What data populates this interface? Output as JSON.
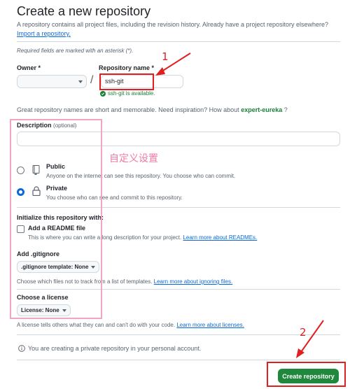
{
  "header": {
    "title": "Create a new repository",
    "subtitle": "A repository contains all project files, including the revision history. Already have a project repository elsewhere?",
    "import_link": "Import a repository."
  },
  "required_note": "Required fields are marked with an asterisk (*).",
  "owner": {
    "label": "Owner *",
    "value": ""
  },
  "slash": "/",
  "repo_name": {
    "label": "Repository name *",
    "value": "ssh-git",
    "availability": "ssh-git is available."
  },
  "suggestion": {
    "text": "Great repository names are short and memorable. Need inspiration? How about",
    "name": "expert-eureka",
    "suffix": "?"
  },
  "description": {
    "label": "Description",
    "optional": "(optional)",
    "value": ""
  },
  "visibility": [
    {
      "label": "Public",
      "desc": "Anyone on the internet can see this repository. You choose who can commit.",
      "selected": false,
      "icon": "repo-icon"
    },
    {
      "label": "Private",
      "desc": "You choose who can see and commit to this repository.",
      "selected": true,
      "icon": "lock-icon"
    }
  ],
  "initialize": {
    "heading": "Initialize this repository with:",
    "readme_label": "Add a README file",
    "readme_checked": false,
    "readme_desc": "This is where you can write a long description for your project.",
    "readme_link": "Learn more about READMEs."
  },
  "gitignore": {
    "label": "Add .gitignore",
    "button": ".gitignore template: None",
    "desc": "Choose which files not to track from a list of templates.",
    "link": "Learn more about ignoring files."
  },
  "license": {
    "label": "Choose a license",
    "button": "License: None",
    "desc": "A license tells others what they can and can't do with your code.",
    "link": "Learn more about licenses."
  },
  "private_notice": "You are creating a private repository in your personal account.",
  "create_button": "Create repository",
  "annotations": {
    "step1": "1",
    "step2": "2",
    "custom_settings": "自定义设置",
    "color": "#e02020",
    "highlight_color": "#f3a3c4"
  },
  "colors": {
    "primary_button": "#1f883d",
    "success": "#1a7f37",
    "link": "#0969da"
  }
}
